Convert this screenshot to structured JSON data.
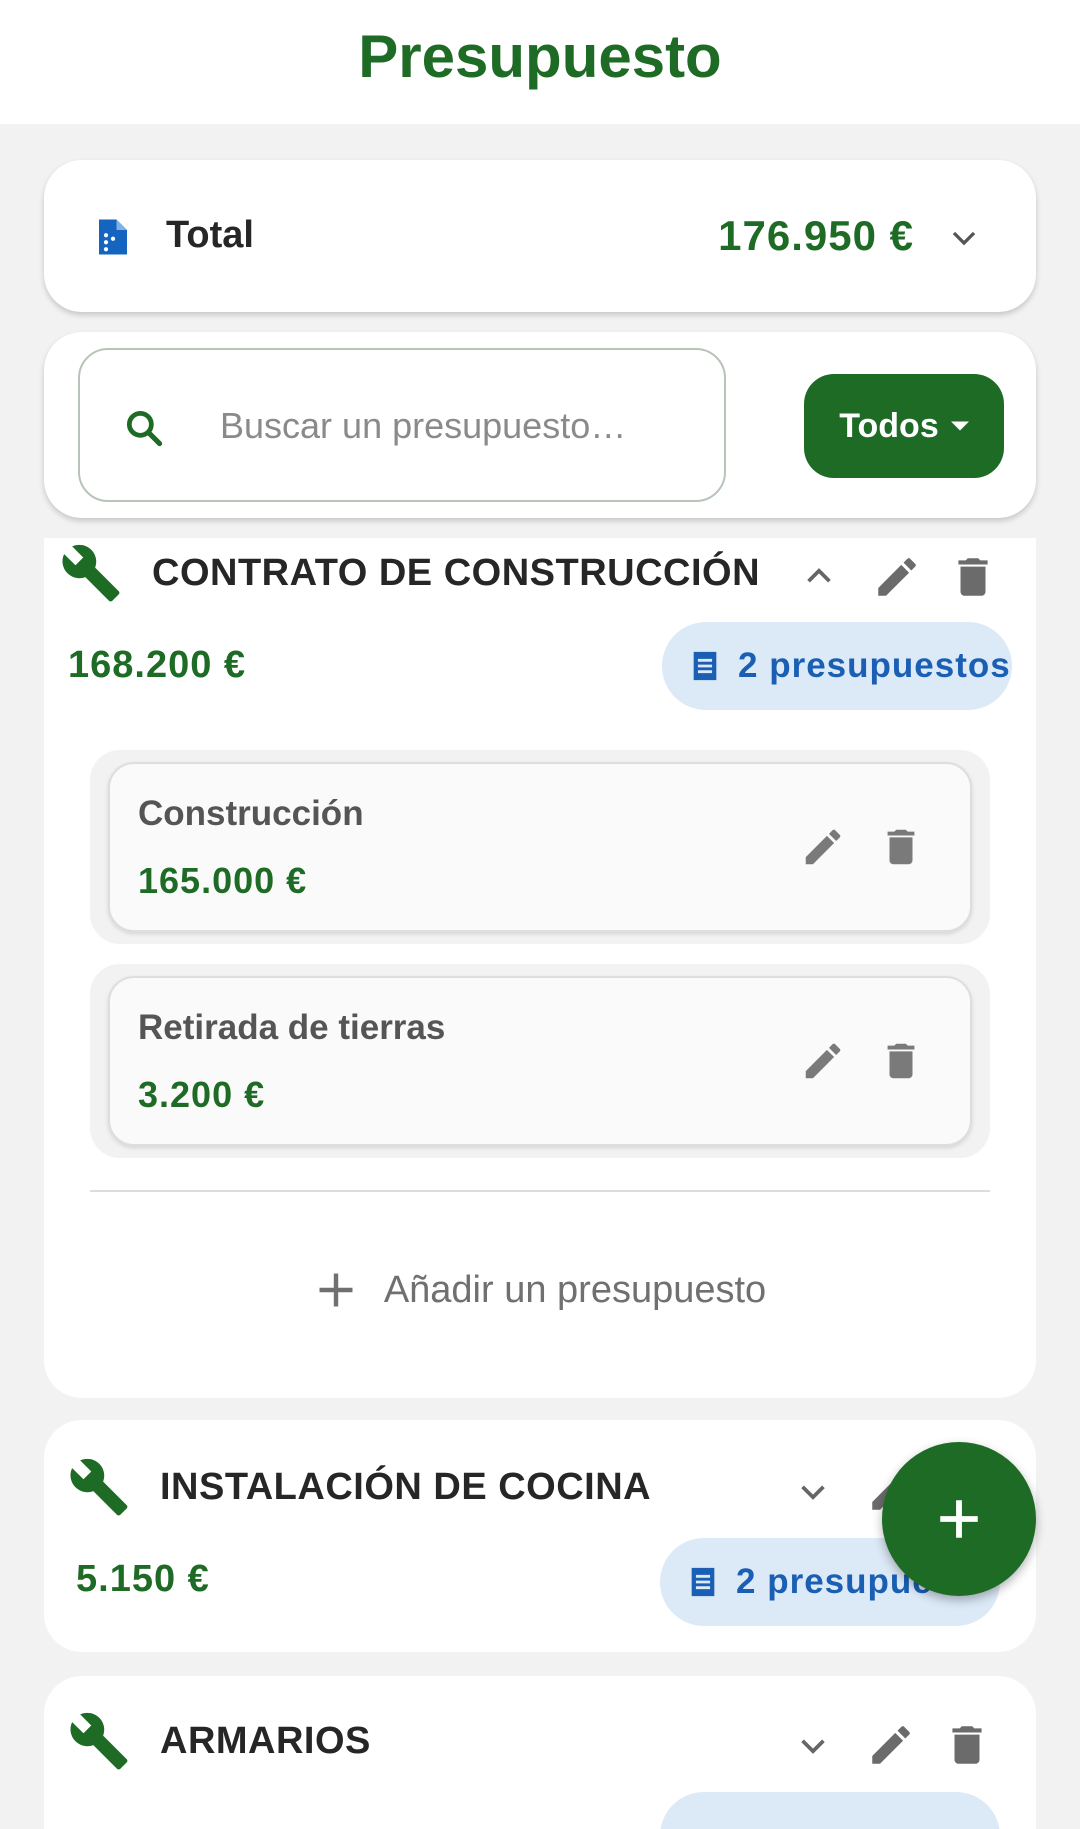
{
  "header": {
    "title": "Presupuesto"
  },
  "total": {
    "label": "Total",
    "amount": "176.950 €"
  },
  "search": {
    "placeholder": "Buscar un presupuesto…",
    "filter_label": "Todos"
  },
  "groups": [
    {
      "title": "CONTRATO DE CONSTRUCCIÓN",
      "amount": "168.200 €",
      "count_label": "2 presupuestos",
      "expanded": true,
      "items": [
        {
          "name": "Construcción",
          "amount": "165.000 €"
        },
        {
          "name": "Retirada de tierras",
          "amount": "3.200 €"
        }
      ],
      "add_label": "Añadir un presupuesto"
    },
    {
      "title": "INSTALACIÓN DE COCINA",
      "amount": "5.150 €",
      "count_label": "2 presupues",
      "expanded": false
    },
    {
      "title": "ARMARIOS",
      "expanded": false
    }
  ],
  "icons": {
    "total": "document-icon",
    "search": "search-icon",
    "group": "wrench-icon",
    "edit": "pencil-icon",
    "delete": "trash-icon",
    "count": "receipt-icon",
    "fab": "plus-icon"
  },
  "colors": {
    "primary": "#1e6b25",
    "badge_bg": "#dce9f6",
    "badge_text": "#1a5fb4",
    "document_icon": "#1565c0",
    "background": "#f2f2f2"
  }
}
